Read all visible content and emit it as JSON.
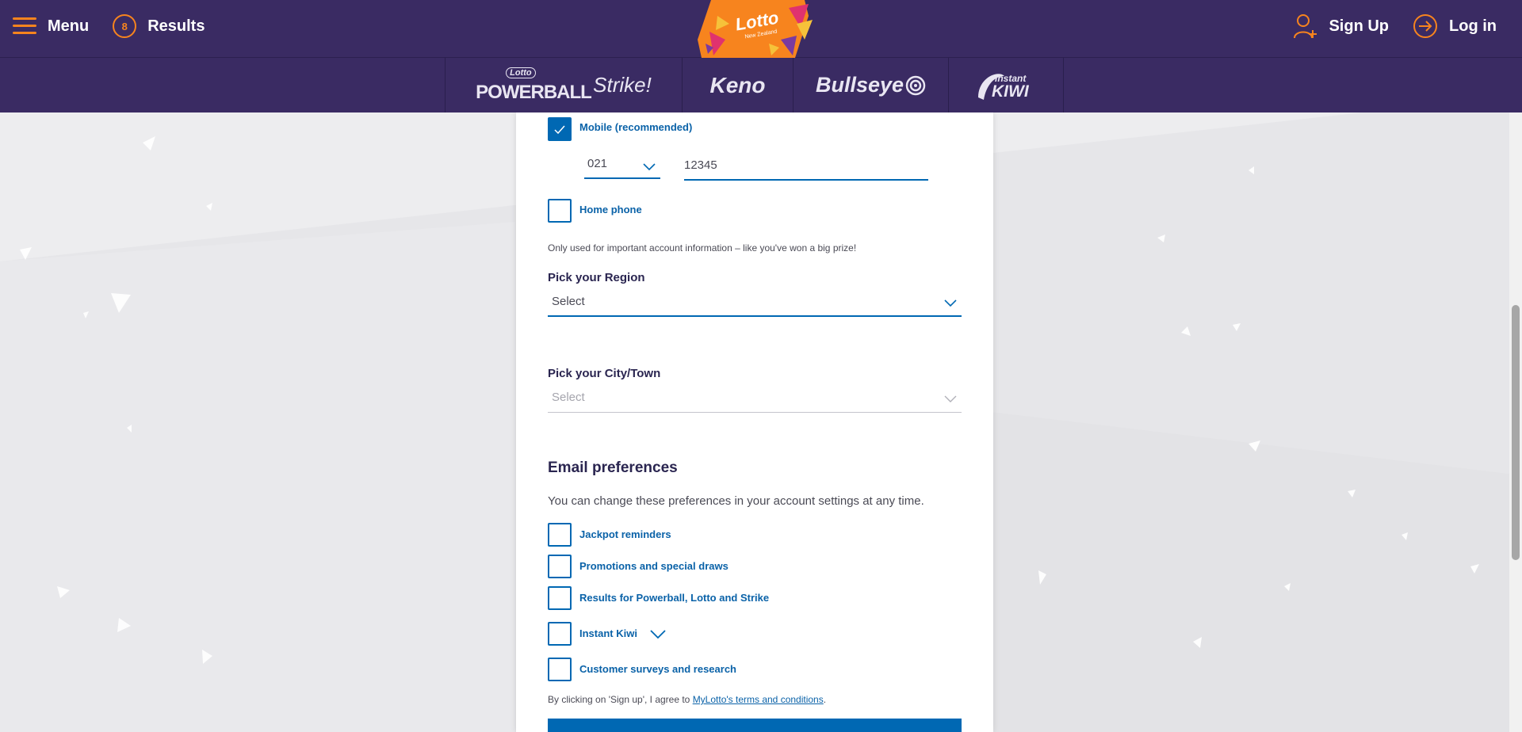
{
  "header": {
    "menu_label": "Menu",
    "results_label": "Results",
    "results_ball": "8",
    "signup_label": "Sign Up",
    "login_label": "Log in",
    "logo_text": "Lotto",
    "logo_subtext": "New Zealand"
  },
  "products": [
    {
      "label": "Powerball",
      "badge": "Lotto"
    },
    {
      "label": "Strike!"
    },
    {
      "label": "Keno"
    },
    {
      "label": "Bullseye"
    },
    {
      "label": "KIWI",
      "badge": "instant"
    }
  ],
  "form": {
    "mobile_label": "Mobile (recommended)",
    "mobile_prefix": "021",
    "mobile_number": "12345",
    "home_phone_label": "Home phone",
    "phone_note": "Only used for important account information – like you've won a big prize!",
    "region_label": "Pick your Region",
    "region_value": "Select",
    "city_label": "Pick your City/Town",
    "city_value": "Select",
    "email_heading": "Email preferences",
    "email_desc": "You can change these preferences in your account settings at any time.",
    "email_options": [
      "Jackpot reminders",
      "Promotions and special draws",
      "Results for Powerball, Lotto and Strike",
      "Instant Kiwi",
      "Customer surveys and research"
    ],
    "terms_prefix": "By clicking on 'Sign up', I agree to ",
    "terms_link": "MyLotto's terms and conditions",
    "terms_suffix": "."
  },
  "colors": {
    "nav_bg": "#3a2b63",
    "accent_orange": "#f7841e",
    "primary_blue": "#0068b3"
  }
}
